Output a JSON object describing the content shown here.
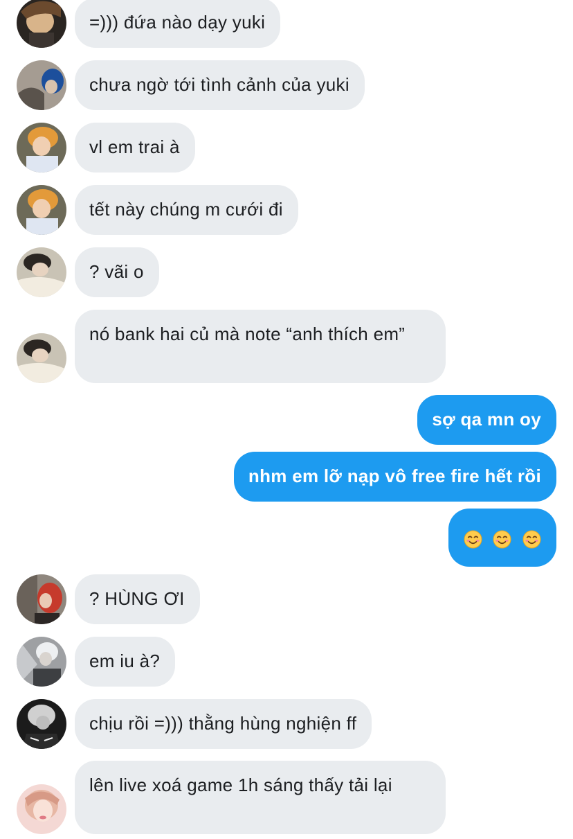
{
  "messages": [
    {
      "side": "in",
      "avatar": "avatar-dark-hair-tan",
      "text": "=))) đứa nào dạy yuki"
    },
    {
      "side": "in",
      "avatar": "avatar-blue-hair",
      "text": "chưa ngờ tới tình cảnh của yuki"
    },
    {
      "side": "in",
      "avatar": "avatar-orange-hair",
      "text": "vl em trai à"
    },
    {
      "side": "in",
      "avatar": "avatar-orange-hair",
      "text": "tết này chúng m cưới đi"
    },
    {
      "side": "in",
      "avatar": "avatar-pillow-boy",
      "text": "? vãi o"
    },
    {
      "side": "in",
      "avatar": "avatar-pillow-boy",
      "text": "nó bank hai củ mà note “anh thích em”"
    },
    {
      "side": "out",
      "text": "sợ qa mn oy"
    },
    {
      "side": "out",
      "text": "nhm em lỡ nạp vô free fire hết rồi"
    },
    {
      "side": "out",
      "text": "",
      "emoji": [
        "smiling-face-icon",
        "smiling-face-icon",
        "smiling-face-icon"
      ]
    },
    {
      "side": "in",
      "avatar": "avatar-red-hair",
      "text": "? HÙNG ƠI"
    },
    {
      "side": "in",
      "avatar": "avatar-white-hair",
      "text": "em iu à?"
    },
    {
      "side": "in",
      "avatar": "avatar-grey-hair-bw",
      "text": "chịu rồi =))) thằng hùng nghiện ff"
    },
    {
      "side": "in",
      "avatar": "avatar-pink-girl",
      "text": "lên live xoá game 1h sáng thấy tải lại"
    }
  ],
  "colors": {
    "incoming_bubble": "#e9ecef",
    "outgoing_bubble": "#1d9bf0",
    "incoming_text": "#1c1e21",
    "outgoing_text": "#ffffff"
  }
}
